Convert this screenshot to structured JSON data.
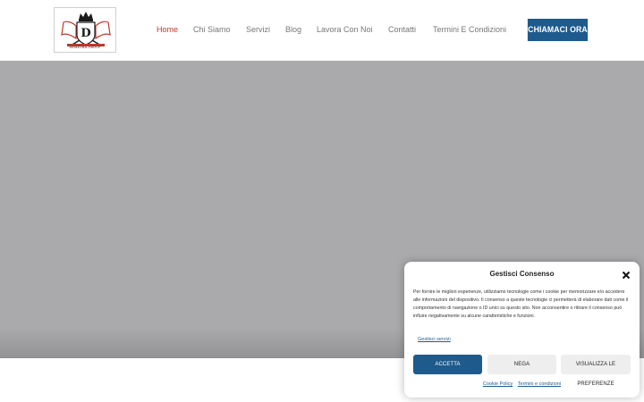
{
  "logo": {
    "text": "DEMETRA GROUP"
  },
  "nav": {
    "items": [
      {
        "label": "Home",
        "active": true
      },
      {
        "label": "Chi Siamo",
        "active": false
      },
      {
        "label": "Servizi",
        "active": false
      },
      {
        "label": "Blog",
        "active": false
      },
      {
        "label": "Lavora Con Noi",
        "active": false
      },
      {
        "label": "Contatti",
        "active": false
      },
      {
        "label": "Termini E Condizioni",
        "active": false
      }
    ]
  },
  "cta": {
    "label": "CHIAMACI ORA"
  },
  "consent": {
    "title": "Gestisci Consenso",
    "body": "Per fornire le migliori esperienze, utilizziamo tecnologie come i cookie per memorizzare e/o accedere alle informazioni del dispositivo. Il consenso a queste tecnologie ci permetterà di elaborare dati come il comportamento di navigazione o ID unici su questo sito. Non acconsentire o ritirare il consenso può influire negativamente su alcune caratteristiche e funzioni.",
    "manage_link": "Gestisci servizi",
    "accept_label": "ACCETTA",
    "deny_label": "NEGA",
    "prefs_label": "VISUALIZZA LE PREFERENZE",
    "cookie_policy_link": "Cookie Policy",
    "terms_link": "Termini e condizioni"
  },
  "colors": {
    "accent": "#1e5a8c",
    "active_nav": "#c0392b",
    "hero_bg": "#aaaaac"
  }
}
